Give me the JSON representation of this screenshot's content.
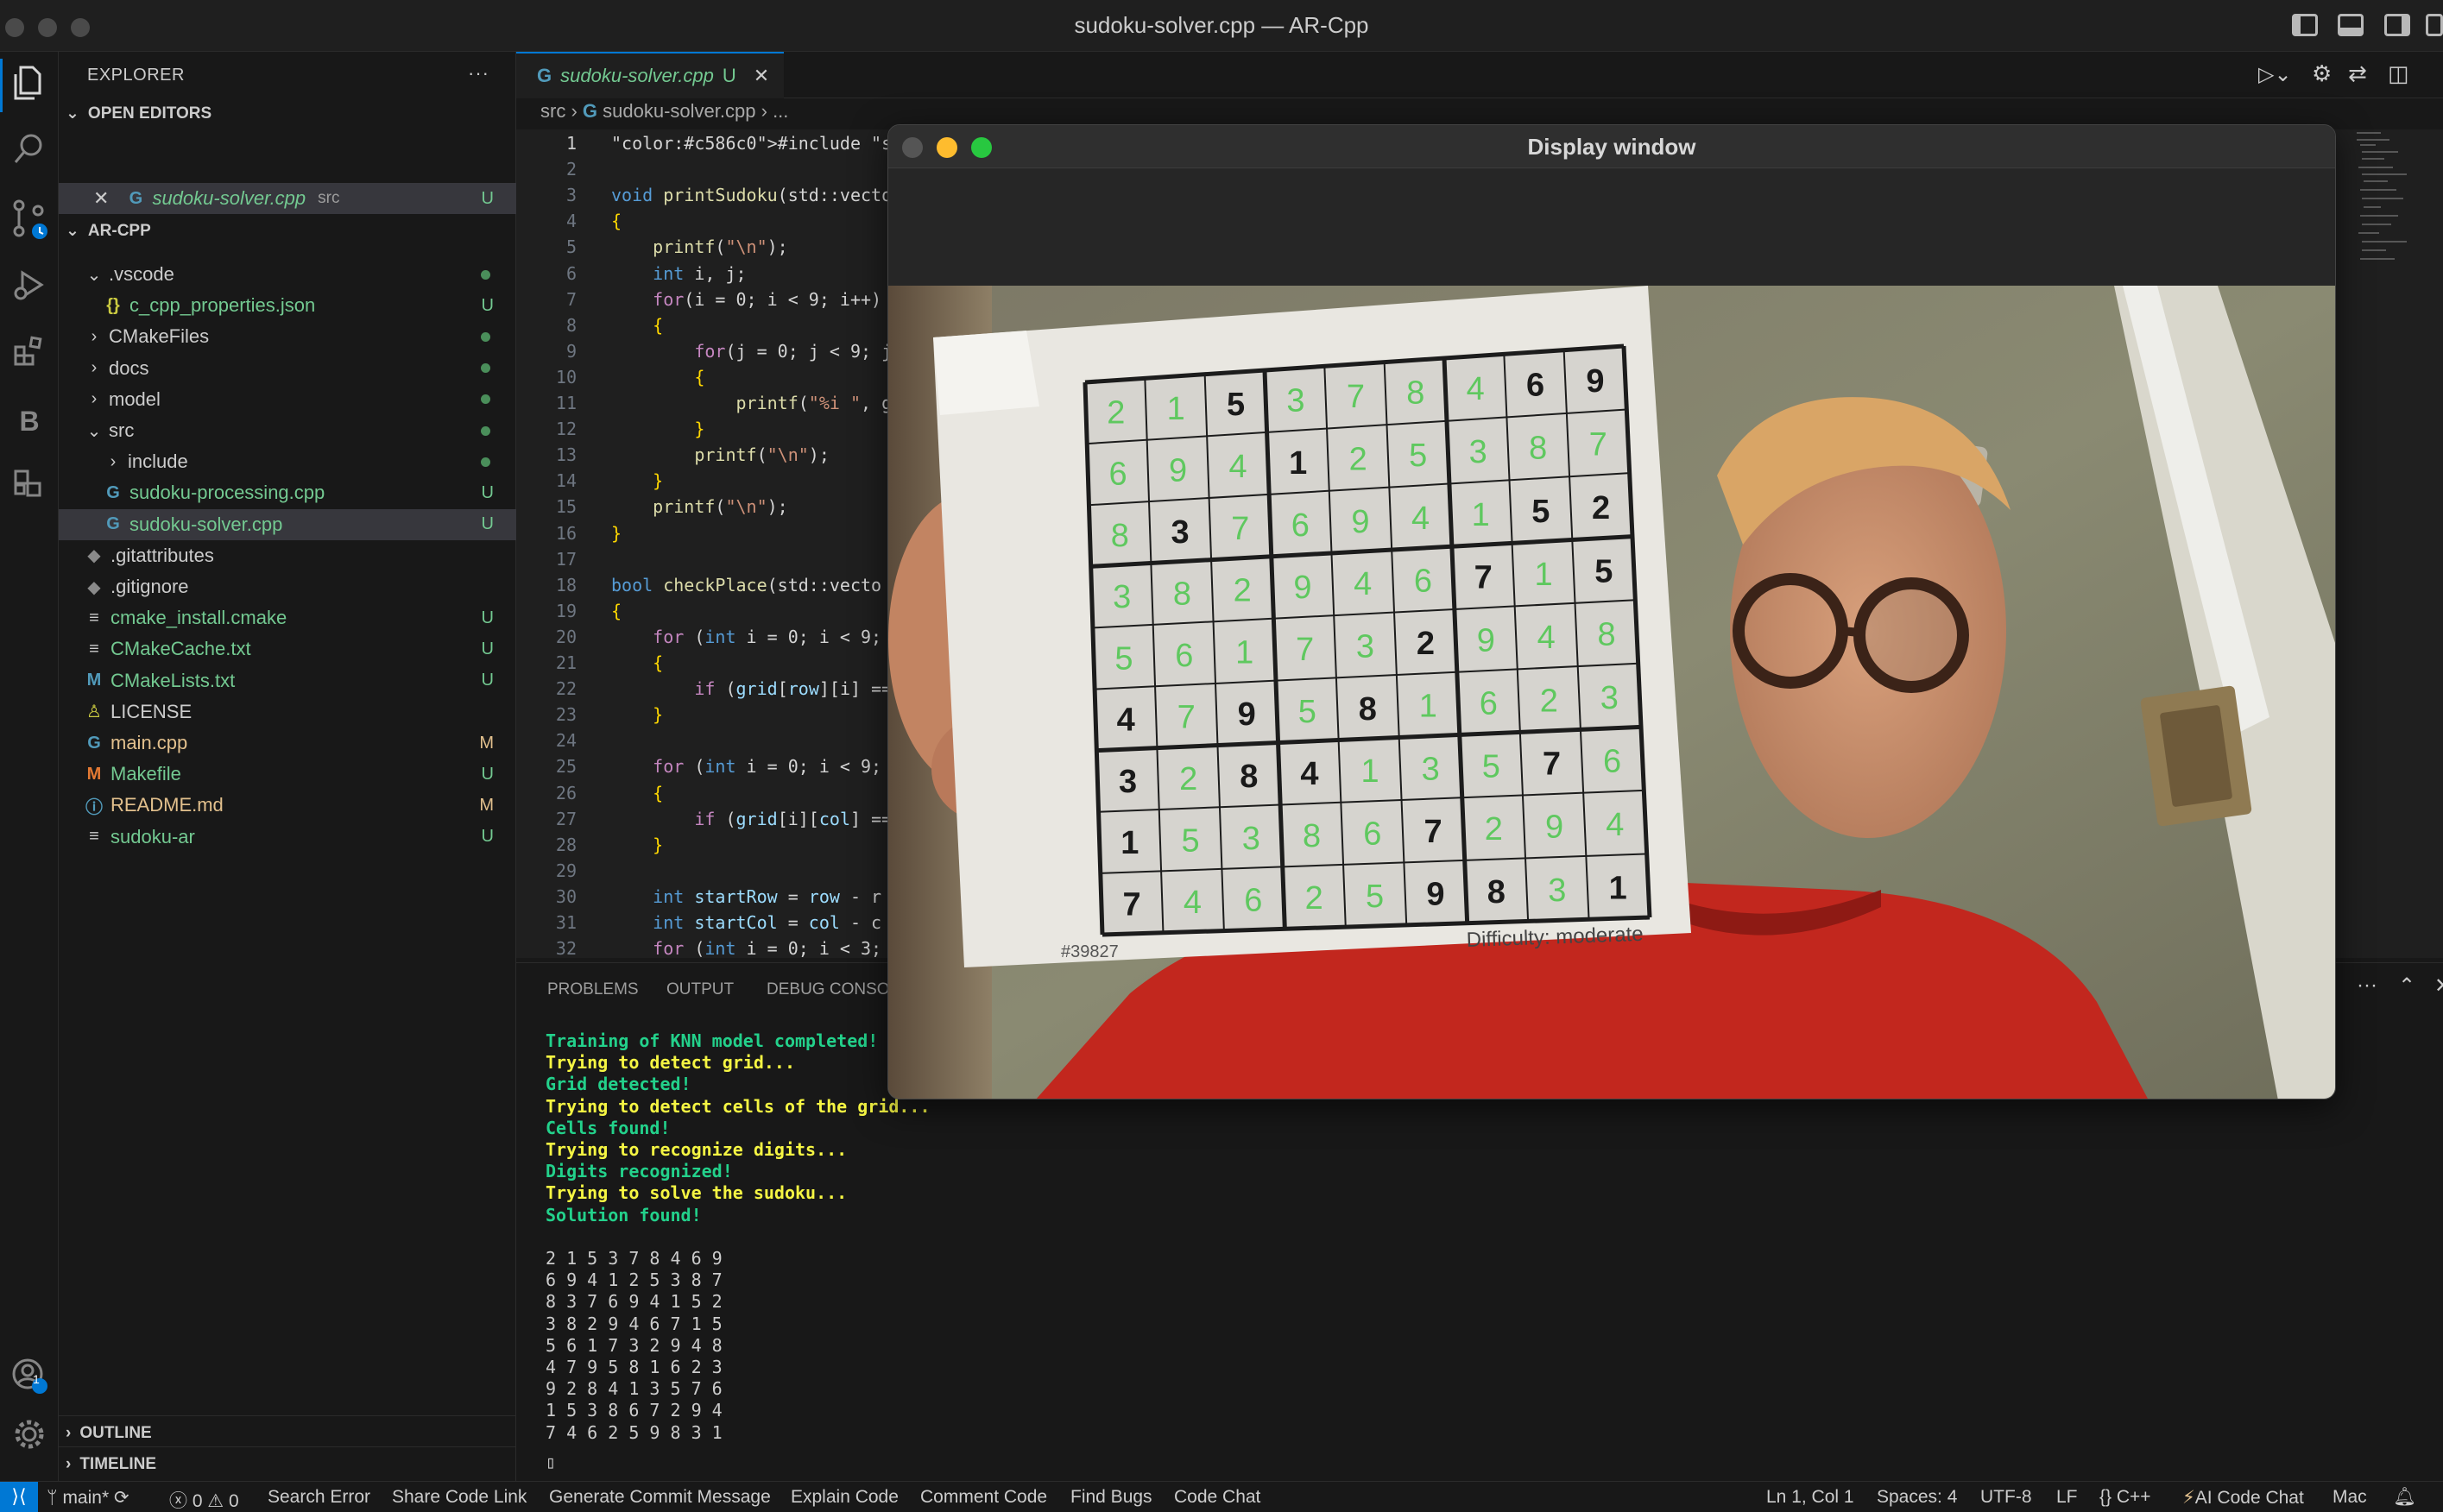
{
  "window": {
    "title": "sudoku-solver.cpp — AR-Cpp"
  },
  "activity_bar": {
    "icons": [
      "files-icon",
      "search-icon",
      "source-control-icon",
      "run-debug-icon",
      "extensions-icon",
      "b-icon",
      "remote-explorer-icon"
    ],
    "account_badge": "1"
  },
  "sidebar": {
    "header": "EXPLORER",
    "more": "···",
    "open_editors_title": "OPEN EDITORS",
    "open_editor": {
      "name": "sudoku-solver.cpp",
      "folder": "src",
      "status": "U"
    },
    "project_title": "AR-CPP",
    "tree": [
      {
        "name": ".vscode",
        "kind": "folder-open",
        "depth": 1,
        "status": "dot"
      },
      {
        "name": "c_cpp_properties.json",
        "kind": "json",
        "depth": 2,
        "status": "U"
      },
      {
        "name": "CMakeFiles",
        "kind": "folder",
        "depth": 1,
        "status": "dot"
      },
      {
        "name": "docs",
        "kind": "folder",
        "depth": 1,
        "status": "dot"
      },
      {
        "name": "model",
        "kind": "folder",
        "depth": 1,
        "status": "dot"
      },
      {
        "name": "src",
        "kind": "folder-open",
        "depth": 1,
        "status": "dot"
      },
      {
        "name": "include",
        "kind": "folder",
        "depth": 2,
        "status": "dot"
      },
      {
        "name": "sudoku-processing.cpp",
        "kind": "cpp",
        "depth": 2,
        "status": "U"
      },
      {
        "name": "sudoku-solver.cpp",
        "kind": "cpp",
        "depth": 2,
        "status": "U"
      },
      {
        "name": ".gitattributes",
        "kind": "git",
        "depth": 1,
        "status": ""
      },
      {
        "name": ".gitignore",
        "kind": "git",
        "depth": 1,
        "status": ""
      },
      {
        "name": "cmake_install.cmake",
        "kind": "text",
        "depth": 1,
        "status": "U"
      },
      {
        "name": "CMakeCache.txt",
        "kind": "text",
        "depth": 1,
        "status": "U"
      },
      {
        "name": "CMakeLists.txt",
        "kind": "md",
        "depth": 1,
        "status": "U"
      },
      {
        "name": "LICENSE",
        "kind": "license",
        "depth": 1,
        "status": ""
      },
      {
        "name": "main.cpp",
        "kind": "cpp",
        "depth": 1,
        "status": "M"
      },
      {
        "name": "Makefile",
        "kind": "make",
        "depth": 1,
        "status": "U"
      },
      {
        "name": "README.md",
        "kind": "info",
        "depth": 1,
        "status": "M"
      },
      {
        "name": "sudoku-ar",
        "kind": "text",
        "depth": 1,
        "status": "U"
      }
    ],
    "outline": "OUTLINE",
    "timeline": "TIMELINE"
  },
  "editor": {
    "tab": {
      "name": "sudoku-solver.cpp",
      "status": "U"
    },
    "breadcrumb": [
      "src",
      "sudoku-solver.cpp",
      "..."
    ],
    "lines": [
      "#include \"sudoku-solver.h\"",
      "",
      "void printSudoku(std::vecto",
      "{",
      "    printf(\"\\n\");",
      "    int i, j;",
      "    for(i = 0; i < 9; i++)",
      "    {",
      "        for(j = 0; j < 9; j",
      "        {",
      "            printf(\"%i \", g",
      "        }",
      "        printf(\"\\n\");",
      "    }",
      "    printf(\"\\n\");",
      "}",
      "",
      "bool checkPlace(std::vecto",
      "{",
      "    for (int i = 0; i < 9;",
      "    {",
      "        if (grid[row][i] ==",
      "    }",
      "",
      "    for (int i = 0; i < 9;",
      "    {",
      "        if (grid[i][col] ==",
      "    }",
      "",
      "    int startRow = row - r",
      "    int startCol = col - c",
      "    for (int i = 0; i < 3;"
    ]
  },
  "panel": {
    "tabs": [
      "PROBLEMS",
      "OUTPUT",
      "DEBUG CONSOLE"
    ],
    "terminal": [
      {
        "text": "Training of KNN model completed!",
        "color": "#23d18b"
      },
      {
        "text": "Trying to detect grid...",
        "color": "#f5f543"
      },
      {
        "text": "Grid detected!",
        "color": "#23d18b"
      },
      {
        "text": "Trying to detect cells of the grid...",
        "color": "#f5f543"
      },
      {
        "text": "Cells found!",
        "color": "#23d18b"
      },
      {
        "text": "Trying to recognize digits...",
        "color": "#f5f543"
      },
      {
        "text": "Digits recognized!",
        "color": "#23d18b"
      },
      {
        "text": "Trying to solve the sudoku...",
        "color": "#f5f543"
      },
      {
        "text": "Solution found!",
        "color": "#23d18b"
      },
      {
        "text": "",
        "color": "#cccccc"
      },
      {
        "text": "2 1 5 3 7 8 4 6 9",
        "color": "#cccccc"
      },
      {
        "text": "6 9 4 1 2 5 3 8 7",
        "color": "#cccccc"
      },
      {
        "text": "8 3 7 6 9 4 1 5 2",
        "color": "#cccccc"
      },
      {
        "text": "3 8 2 9 4 6 7 1 5",
        "color": "#cccccc"
      },
      {
        "text": "5 6 1 7 3 2 9 4 8",
        "color": "#cccccc"
      },
      {
        "text": "4 7 9 5 8 1 6 2 3",
        "color": "#cccccc"
      },
      {
        "text": "9 2 8 4 1 3 5 7 6",
        "color": "#cccccc"
      },
      {
        "text": "1 5 3 8 6 7 2 9 4",
        "color": "#cccccc"
      },
      {
        "text": "7 4 6 2 5 9 8 3 1",
        "color": "#cccccc"
      }
    ],
    "cursor": "▯"
  },
  "display_window": {
    "title": "Display window",
    "sudoku": {
      "grid": [
        [
          2,
          1,
          5,
          3,
          7,
          8,
          4,
          6,
          9
        ],
        [
          6,
          9,
          4,
          1,
          2,
          5,
          3,
          8,
          7
        ],
        [
          8,
          3,
          7,
          6,
          9,
          4,
          1,
          5,
          2
        ],
        [
          3,
          8,
          2,
          9,
          4,
          6,
          7,
          1,
          5
        ],
        [
          5,
          6,
          1,
          7,
          3,
          2,
          9,
          4,
          8
        ],
        [
          4,
          7,
          9,
          5,
          8,
          1,
          6,
          2,
          3
        ],
        [
          3,
          2,
          8,
          4,
          1,
          3,
          5,
          7,
          6
        ],
        [
          1,
          5,
          3,
          8,
          6,
          7,
          2,
          9,
          4
        ],
        [
          7,
          4,
          6,
          2,
          5,
          9,
          8,
          3,
          1
        ]
      ],
      "given": [
        [
          0,
          0,
          1,
          0,
          0,
          0,
          0,
          1,
          1
        ],
        [
          0,
          0,
          0,
          1,
          0,
          0,
          0,
          0,
          0
        ],
        [
          0,
          1,
          0,
          0,
          0,
          0,
          0,
          1,
          1
        ],
        [
          0,
          0,
          0,
          0,
          0,
          0,
          1,
          0,
          1
        ],
        [
          0,
          0,
          0,
          0,
          0,
          1,
          0,
          0,
          0
        ],
        [
          1,
          0,
          1,
          0,
          1,
          0,
          0,
          0,
          0
        ],
        [
          1,
          0,
          1,
          1,
          0,
          0,
          0,
          1,
          0
        ],
        [
          1,
          0,
          0,
          0,
          0,
          1,
          0,
          0,
          0
        ],
        [
          1,
          0,
          0,
          0,
          0,
          1,
          1,
          0,
          1
        ]
      ],
      "puzzle_id": "#39827",
      "difficulty": "Difficulty: moderate"
    }
  },
  "status_bar": {
    "branch": "main*",
    "errors": "0",
    "warnings": "0",
    "search_error": "Search Error",
    "share": "Share Code Link",
    "commit": "Generate Commit Message",
    "explain": "Explain Code",
    "comment": "Comment Code",
    "bugs": "Find Bugs",
    "chat": "Code Chat",
    "position": "Ln 1, Col 1",
    "spaces": "Spaces: 4",
    "encoding": "UTF-8",
    "eol": "LF",
    "language": "C++",
    "ai_chat": "AI Code Chat",
    "mac": "Mac"
  },
  "colors": {
    "accent": "#0078d4",
    "untracked": "#73c991",
    "modified": "#e2c08d",
    "ok": "#23d18b",
    "warn": "#f5f543"
  }
}
